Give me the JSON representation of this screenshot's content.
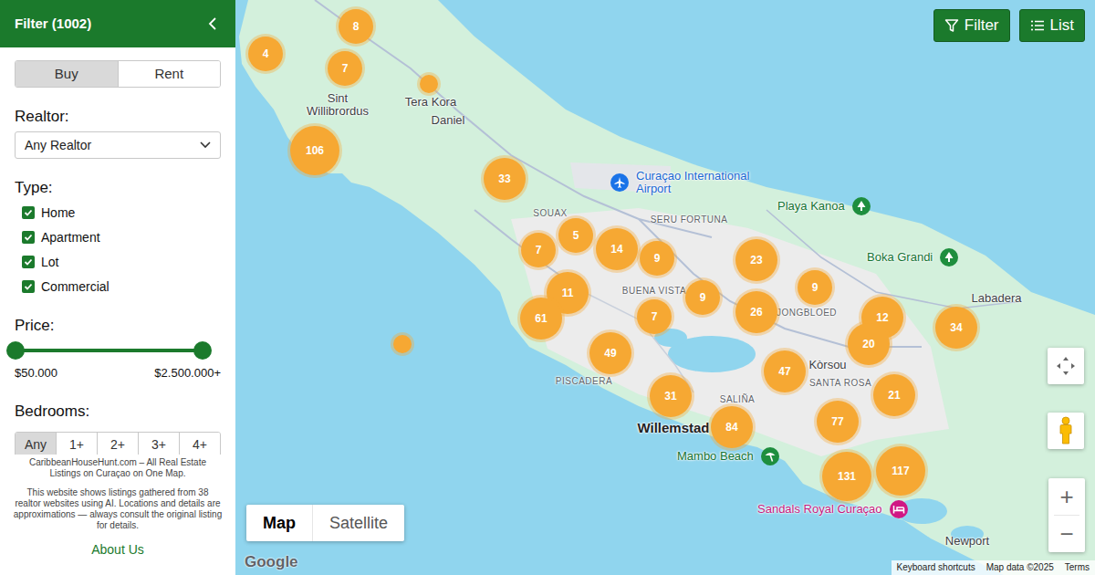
{
  "sidebar": {
    "title": "Filter (1002)",
    "tabs": [
      {
        "label": "Buy",
        "selected": true
      },
      {
        "label": "Rent",
        "selected": false
      }
    ],
    "realtor": {
      "label": "Realtor:",
      "value": "Any Realtor"
    },
    "type": {
      "label": "Type:",
      "options": [
        {
          "label": "Home",
          "checked": true
        },
        {
          "label": "Apartment",
          "checked": true
        },
        {
          "label": "Lot",
          "checked": true
        },
        {
          "label": "Commercial",
          "checked": true
        }
      ]
    },
    "price": {
      "label": "Price:",
      "thumbs": [
        {
          "level": 0
        },
        {
          "level": 1
        }
      ],
      "min": "$50.000",
      "max": "$2.500.000+"
    },
    "bedrooms": {
      "label": "Bedrooms:",
      "options": [
        {
          "label": "Any",
          "selected": true
        },
        {
          "label": "1+",
          "selected": false
        },
        {
          "label": "2+",
          "selected": false
        },
        {
          "label": "3+",
          "selected": false
        },
        {
          "label": "4+",
          "selected": false
        }
      ]
    },
    "footer": {
      "lines": [
        "CaribbeanHouseHunt.com – All Real Estate Listings on Curaçao on One Map.",
        "This website shows listings gathered from 38 realtor websites using AI. Locations and details are approximations — always consult the original listing for details."
      ],
      "link": "About Us"
    }
  },
  "map": {
    "buttons": [
      {
        "label": "Filter"
      },
      {
        "label": "List"
      }
    ],
    "places": [
      {
        "label": "Sint Willibrordus",
        "kind": "town"
      },
      {
        "label": "Tera Kora",
        "kind": "town"
      },
      {
        "label": "Daniel",
        "kind": "town"
      },
      {
        "label": "Curaçao International Airport",
        "kind": "airport"
      },
      {
        "label": "SOUAX",
        "kind": "district"
      },
      {
        "label": "SERU FORTUNA",
        "kind": "district"
      },
      {
        "label": "BUENA VISTA",
        "kind": "district"
      },
      {
        "label": "JONGBLOED",
        "kind": "district"
      },
      {
        "label": "Kòrsou",
        "kind": "town"
      },
      {
        "label": "SANTA ROSA",
        "kind": "district"
      },
      {
        "label": "SALIÑA",
        "kind": "district"
      },
      {
        "label": "PISCADERA",
        "kind": "district"
      },
      {
        "label": "Willemstad",
        "kind": "city"
      },
      {
        "label": "Playa Kanoa",
        "kind": "park"
      },
      {
        "label": "Boka Grandi",
        "kind": "park"
      },
      {
        "label": "Labadera",
        "kind": "town"
      },
      {
        "label": "Mambo Beach",
        "kind": "beach"
      },
      {
        "label": "Sandals Royal Curaçao",
        "kind": "hotel"
      },
      {
        "label": "Newport",
        "kind": "town"
      }
    ],
    "markers": [
      {
        "kind": "cluster",
        "count": "8"
      },
      {
        "kind": "cluster",
        "count": "4"
      },
      {
        "kind": "cluster",
        "count": "7"
      },
      {
        "kind": "cluster",
        "count": "106"
      },
      {
        "kind": "single"
      },
      {
        "kind": "cluster",
        "count": "33"
      },
      {
        "kind": "cluster",
        "count": "5"
      },
      {
        "kind": "cluster",
        "count": "7"
      },
      {
        "kind": "cluster",
        "count": "14"
      },
      {
        "kind": "cluster",
        "count": "9"
      },
      {
        "kind": "cluster",
        "count": "23"
      },
      {
        "kind": "cluster",
        "count": "11"
      },
      {
        "kind": "cluster",
        "count": "9"
      },
      {
        "kind": "cluster",
        "count": "9"
      },
      {
        "kind": "cluster",
        "count": "7"
      },
      {
        "kind": "cluster",
        "count": "26"
      },
      {
        "kind": "cluster",
        "count": "12"
      },
      {
        "kind": "cluster",
        "count": "61"
      },
      {
        "kind": "cluster",
        "count": "34"
      },
      {
        "kind": "cluster",
        "count": "20"
      },
      {
        "kind": "cluster",
        "count": "49"
      },
      {
        "kind": "single"
      },
      {
        "kind": "cluster",
        "count": "47"
      },
      {
        "kind": "cluster",
        "count": "31"
      },
      {
        "kind": "cluster",
        "count": "21"
      },
      {
        "kind": "cluster",
        "count": "77"
      },
      {
        "kind": "cluster",
        "count": "84"
      },
      {
        "kind": "cluster",
        "count": "131"
      },
      {
        "kind": "cluster",
        "count": "117"
      }
    ],
    "map_types": [
      {
        "label": "Map",
        "selected": true
      },
      {
        "label": "Satellite",
        "selected": false
      }
    ],
    "zoom": [
      {
        "label": "+"
      },
      {
        "label": "−"
      }
    ],
    "logo": "Google",
    "attribution": [
      "Keyboard shortcuts",
      "Map data ©2025",
      "Terms"
    ]
  }
}
